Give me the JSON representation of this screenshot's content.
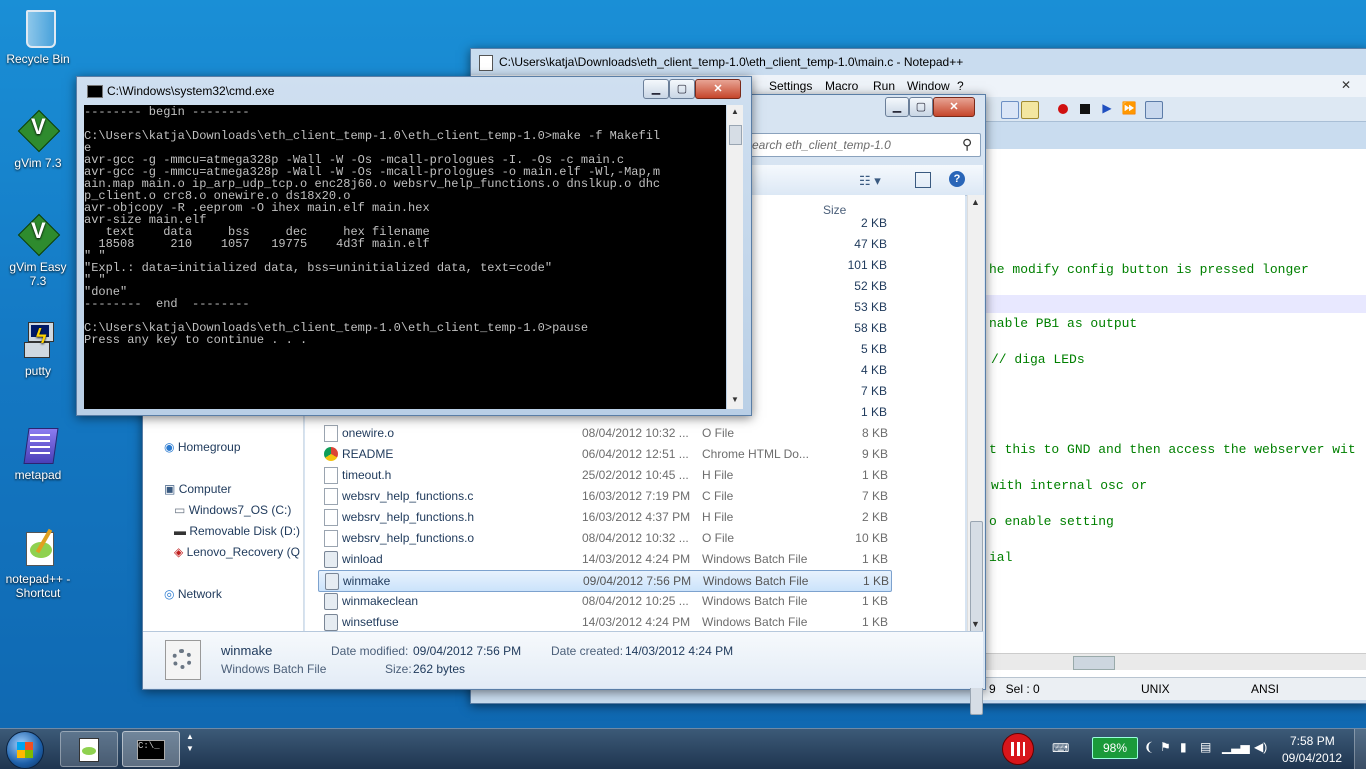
{
  "desktop": {
    "icons": [
      {
        "label": "Recycle Bin"
      },
      {
        "label": "gVim 7.3"
      },
      {
        "label": "gVim Easy 7.3"
      },
      {
        "label": "putty"
      },
      {
        "label": "metapad"
      },
      {
        "label": "notepad++ - Shortcut"
      }
    ]
  },
  "notepad": {
    "title": "C:\\Users\\katja\\Downloads\\eth_client_temp-1.0\\eth_client_temp-1.0\\main.c - Notepad++",
    "menu": [
      "Settings",
      "Macro",
      "Run",
      "Window",
      "?"
    ],
    "code_lines": [
      "he modify config button is pressed longer",
      "nable PB1 as output",
      "// diga LEDs",
      "t this to GND and then access the webserver wit",
      "with internal osc or",
      "o enable setting",
      "ial"
    ],
    "status": {
      "sel": "9   Sel : 0",
      "eol": "UNIX",
      "encoding": "ANSI"
    }
  },
  "explorer": {
    "search_placeholder": "earch eth_client_temp-1.0",
    "col_size": "Size",
    "top_sizes": [
      "2 KB",
      "47 KB",
      "101 KB",
      "52 KB",
      "53 KB",
      "58 KB",
      "5 KB",
      "4 KB",
      "7 KB",
      "1 KB"
    ],
    "nav": {
      "homegroup": "Homegroup",
      "computer": "Computer",
      "c_drive": "Windows7_OS (C:)",
      "d_drive": "Removable Disk (D:)",
      "q_drive": "Lenovo_Recovery (Q",
      "network": "Network"
    },
    "files": [
      {
        "name": "onewire.o",
        "date": "08/04/2012 10:32 ...",
        "type": "O File",
        "size": "8 KB"
      },
      {
        "name": "README",
        "date": "06/04/2012 12:51 ...",
        "type": "Chrome HTML Do...",
        "size": "9 KB"
      },
      {
        "name": "timeout.h",
        "date": "25/02/2012 10:45 ...",
        "type": "H File",
        "size": "1 KB"
      },
      {
        "name": "websrv_help_functions.c",
        "date": "16/03/2012 7:19 PM",
        "type": "C File",
        "size": "7 KB"
      },
      {
        "name": "websrv_help_functions.h",
        "date": "16/03/2012 4:37 PM",
        "type": "H File",
        "size": "2 KB"
      },
      {
        "name": "websrv_help_functions.o",
        "date": "08/04/2012 10:32 ...",
        "type": "O File",
        "size": "10 KB"
      },
      {
        "name": "winload",
        "date": "14/03/2012 4:24 PM",
        "type": "Windows Batch File",
        "size": "1 KB"
      },
      {
        "name": "winmake",
        "date": "09/04/2012 7:56 PM",
        "type": "Windows Batch File",
        "size": "1 KB"
      },
      {
        "name": "winmakeclean",
        "date": "08/04/2012 10:25 ...",
        "type": "Windows Batch File",
        "size": "1 KB"
      },
      {
        "name": "winsetfuse",
        "date": "14/03/2012 4:24 PM",
        "type": "Windows Batch File",
        "size": "1 KB"
      }
    ],
    "details": {
      "name": "winmake",
      "type": "Windows Batch File",
      "modified_label": "Date modified:",
      "modified": "09/04/2012 7:56 PM",
      "created_label": "Date created:",
      "created": "14/03/2012 4:24 PM",
      "size_label": "Size:",
      "size": "262 bytes"
    }
  },
  "cmd": {
    "title": "C:\\Windows\\system32\\cmd.exe",
    "output": "-------- begin --------\n\nC:\\Users\\katja\\Downloads\\eth_client_temp-1.0\\eth_client_temp-1.0>make -f Makefil\ne\navr-gcc -g -mmcu=atmega328p -Wall -W -Os -mcall-prologues -I. -Os -c main.c\navr-gcc -g -mmcu=atmega328p -Wall -W -Os -mcall-prologues -o main.elf -Wl,-Map,m\nain.map main.o ip_arp_udp_tcp.o enc28j60.o websrv_help_functions.o dnslkup.o dhc\np_client.o crc8.o onewire.o ds18x20.o\navr-objcopy -R .eeprom -O ihex main.elf main.hex\navr-size main.elf\n   text    data     bss     dec     hex filename\n  18508     210    1057   19775    4d3f main.elf\n\" \"\n\"Expl.: data=initialized data, bss=uninitialized data, text=code\"\n\" \"\n\"done\"\n--------  end  --------\n\nC:\\Users\\katja\\Downloads\\eth_client_temp-1.0\\eth_client_temp-1.0>pause\nPress any key to continue . . ."
  },
  "taskbar": {
    "battery": "98%",
    "time": "7:58 PM",
    "date": "09/04/2012"
  }
}
